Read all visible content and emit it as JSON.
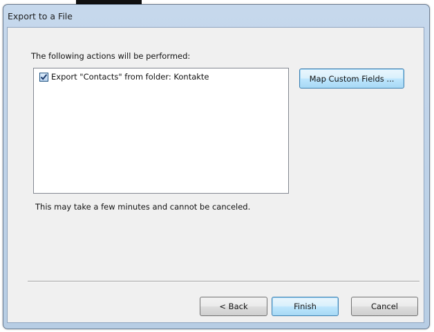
{
  "window": {
    "title": "Export to a File"
  },
  "dialog": {
    "actions_label": "The following actions will be performed:",
    "actions": [
      {
        "label": "Export \"Contacts\" from folder: Kontakte",
        "checked": true
      }
    ],
    "map_fields_label": "Map Custom Fields ...",
    "notice": "This may take a few minutes and cannot be canceled."
  },
  "buttons": {
    "back_label": "< Back",
    "finish_label": "Finish",
    "cancel_label": "Cancel"
  },
  "colors": {
    "title_bar": "#c6d8ec",
    "client_bg": "#f0f0f0",
    "focus_border": "#3c7fb1"
  }
}
